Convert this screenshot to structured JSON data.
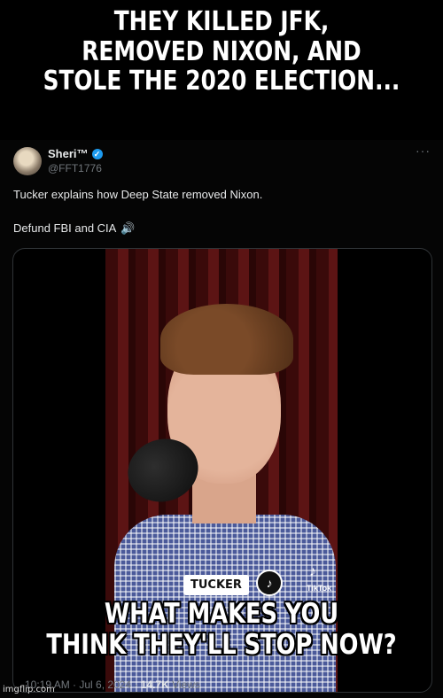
{
  "meme": {
    "top_line1": "THEY KILLED JFK,",
    "top_line2": "REMOVED NIXON, AND",
    "top_line3": "STOLE THE 2020 ELECTION...",
    "bottom_line1": "WHAT MAKES YOU",
    "bottom_line2": "THINK THEY'LL STOP NOW?"
  },
  "tweet": {
    "name": "Sheri™",
    "handle": "@FFT1776",
    "text_line1": "Tucker explains how Deep State removed Nixon.",
    "text_line2": "Defund FBI and CIA",
    "more": "···",
    "speaker_icon": "🔊"
  },
  "video": {
    "lower_third": "TUCKER",
    "tiktok_label": "TikTok"
  },
  "footer": {
    "time": "10:19 AM",
    "separator1": " · ",
    "date": "Jul 6, 2024",
    "separator2": " · ",
    "views_count": "14.7K",
    "views_label": "Views"
  },
  "watermark": "imgflip.com",
  "colors": {
    "background": "#000000",
    "verified": "#1d9bf0",
    "muted_text": "#71767b"
  }
}
